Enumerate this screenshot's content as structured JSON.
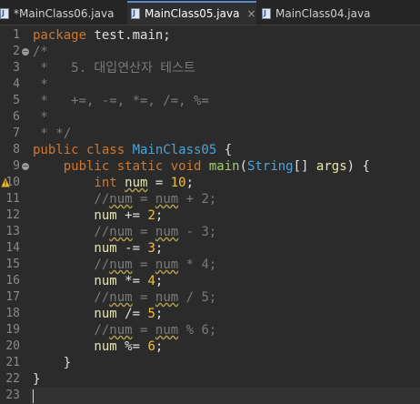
{
  "tabs": [
    {
      "label": "*MainClass06.java",
      "icon": "java-file-icon",
      "active": false
    },
    {
      "label": "MainClass05.java",
      "icon": "java-file-icon",
      "active": true,
      "close": "×"
    },
    {
      "label": "MainClass04.java",
      "icon": "java-file-icon",
      "active": false
    }
  ],
  "editor": {
    "line_numbers": [
      "1",
      "2",
      "3",
      "4",
      "5",
      "6",
      "7",
      "8",
      "9",
      "10",
      "11",
      "12",
      "13",
      "14",
      "15",
      "16",
      "17",
      "18",
      "19",
      "20",
      "21",
      "22",
      "23"
    ],
    "lines": [
      [
        {
          "t": "package",
          "k": "kw"
        },
        {
          "t": " test.main;",
          "k": "pl"
        }
      ],
      [
        {
          "t": "/*",
          "k": "cmt"
        }
      ],
      [
        {
          "t": " *   5. 대입연산자 테스트",
          "k": "cmt"
        }
      ],
      [
        {
          "t": " *",
          "k": "cmt"
        }
      ],
      [
        {
          "t": " *   +=, -=, *=, /=, %=",
          "k": "cmt"
        }
      ],
      [
        {
          "t": " *",
          "k": "cmt"
        }
      ],
      [
        {
          "t": " * */",
          "k": "cmt"
        }
      ],
      [
        {
          "t": "public class ",
          "k": "kw"
        },
        {
          "t": "MainClass05",
          "k": "cls"
        },
        {
          "t": " {",
          "k": "pl"
        }
      ],
      [
        {
          "t": "    public static void ",
          "k": "kw"
        },
        {
          "t": "main",
          "k": "meth"
        },
        {
          "t": "(",
          "k": "pl"
        },
        {
          "t": "String",
          "k": "cls"
        },
        {
          "t": "[] ",
          "k": "pl"
        },
        {
          "t": "args",
          "k": "var"
        },
        {
          "t": ") {",
          "k": "pl"
        }
      ],
      [
        {
          "t": "        int ",
          "k": "kw"
        },
        {
          "t": "num",
          "k": "var",
          "sq": true
        },
        {
          "t": " = ",
          "k": "pl"
        },
        {
          "t": "10",
          "k": "num"
        },
        {
          "t": ";",
          "k": "pl"
        }
      ],
      [
        {
          "t": "        //",
          "k": "cmt"
        },
        {
          "t": "num",
          "k": "cmt",
          "sq": true
        },
        {
          "t": " = ",
          "k": "cmt"
        },
        {
          "t": "num",
          "k": "cmt",
          "sq": true
        },
        {
          "t": " + 2;",
          "k": "cmt"
        }
      ],
      [
        {
          "t": "        num",
          "k": "var"
        },
        {
          "t": " += ",
          "k": "pl"
        },
        {
          "t": "2",
          "k": "num"
        },
        {
          "t": ";",
          "k": "pl"
        }
      ],
      [
        {
          "t": "        //",
          "k": "cmt"
        },
        {
          "t": "num",
          "k": "cmt",
          "sq": true
        },
        {
          "t": " = ",
          "k": "cmt"
        },
        {
          "t": "num",
          "k": "cmt",
          "sq": true
        },
        {
          "t": " - 3;",
          "k": "cmt"
        }
      ],
      [
        {
          "t": "        num",
          "k": "var"
        },
        {
          "t": " -= ",
          "k": "pl"
        },
        {
          "t": "3",
          "k": "num"
        },
        {
          "t": ";",
          "k": "pl"
        }
      ],
      [
        {
          "t": "        //",
          "k": "cmt"
        },
        {
          "t": "num",
          "k": "cmt",
          "sq": true
        },
        {
          "t": " = ",
          "k": "cmt"
        },
        {
          "t": "num",
          "k": "cmt",
          "sq": true
        },
        {
          "t": " * 4;",
          "k": "cmt"
        }
      ],
      [
        {
          "t": "        num",
          "k": "var"
        },
        {
          "t": " *= ",
          "k": "pl"
        },
        {
          "t": "4",
          "k": "num"
        },
        {
          "t": ";",
          "k": "pl"
        }
      ],
      [
        {
          "t": "        //",
          "k": "cmt"
        },
        {
          "t": "num",
          "k": "cmt",
          "sq": true
        },
        {
          "t": " = ",
          "k": "cmt"
        },
        {
          "t": "num",
          "k": "cmt",
          "sq": true
        },
        {
          "t": " / 5;",
          "k": "cmt"
        }
      ],
      [
        {
          "t": "        num",
          "k": "var"
        },
        {
          "t": " /= ",
          "k": "pl"
        },
        {
          "t": "5",
          "k": "num"
        },
        {
          "t": ";",
          "k": "pl"
        }
      ],
      [
        {
          "t": "        //",
          "k": "cmt"
        },
        {
          "t": "num",
          "k": "cmt",
          "sq": true
        },
        {
          "t": " = ",
          "k": "cmt"
        },
        {
          "t": "num",
          "k": "cmt",
          "sq": true
        },
        {
          "t": " % 6;",
          "k": "cmt"
        }
      ],
      [
        {
          "t": "        num",
          "k": "var"
        },
        {
          "t": " %= ",
          "k": "pl"
        },
        {
          "t": "6",
          "k": "num"
        },
        {
          "t": ";",
          "k": "pl"
        }
      ],
      [
        {
          "t": "    }",
          "k": "pl"
        }
      ],
      [
        {
          "t": "}",
          "k": "pl"
        }
      ],
      []
    ],
    "fold_lines": [
      2,
      9
    ],
    "warning_line": 10,
    "current_line": 23
  }
}
